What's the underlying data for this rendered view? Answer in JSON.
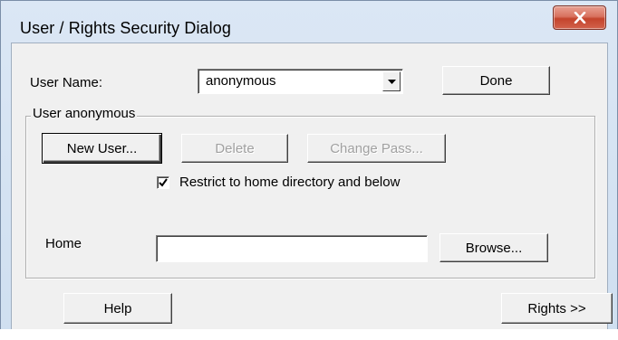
{
  "window": {
    "title": "User / Rights Security Dialog",
    "close_glyph": "X"
  },
  "user_name": {
    "label": "User Name:",
    "value": "anonymous"
  },
  "buttons": {
    "done": "Done",
    "new_user": "New User...",
    "delete": "Delete",
    "change_pass": "Change Pass...",
    "browse": "Browse...",
    "help": "Help",
    "rights": "Rights >>"
  },
  "group": {
    "legend": "User anonymous"
  },
  "restrict": {
    "label": "Restrict to home directory and below",
    "checked": true
  },
  "home": {
    "label": "Home",
    "value": ""
  },
  "colors": {
    "dialog_face": "#f0f0f0",
    "close_red": "#c4442c",
    "frame_blue": "#cfdff0"
  }
}
